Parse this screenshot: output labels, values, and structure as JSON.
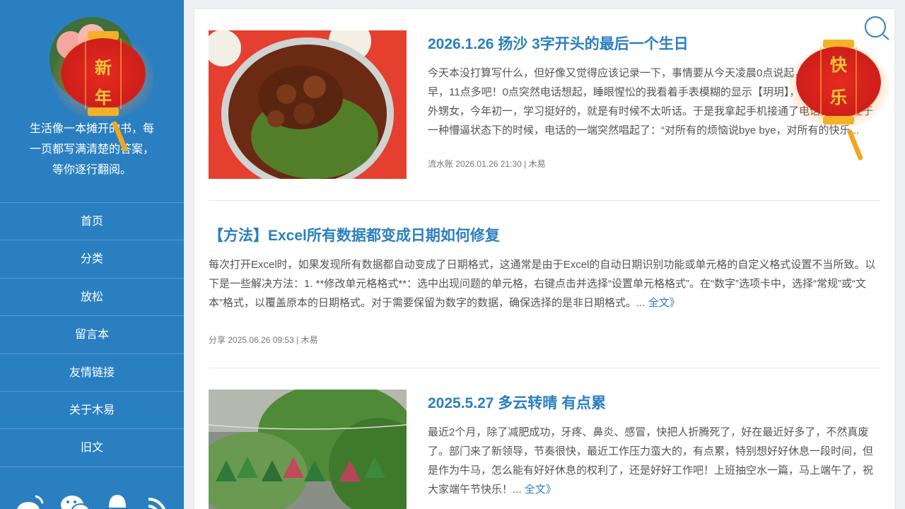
{
  "sidebar": {
    "motto": [
      "生活像一本摊开的书，每",
      "一页都写满清楚的答案，",
      "等你逐行翻阅。"
    ],
    "nav": [
      "首页",
      "分类",
      "放松",
      "留言本",
      "友情链接",
      "关于木易",
      "旧文"
    ],
    "social_icons": [
      "weibo-icon",
      "wechat-icon",
      "qq-icon",
      "rss-icon"
    ]
  },
  "lanterns": {
    "left": {
      "char_top": "新",
      "char_bottom": "年"
    },
    "right": {
      "char_top": "快",
      "char_bottom": "乐"
    }
  },
  "colors": {
    "sidebar": "#2a7fc1",
    "link": "#2a7fc1",
    "lantern_red": "#d4231c",
    "lantern_gold": "#f3b12a"
  },
  "posts": [
    {
      "title": "2026.1.26 扬沙 3字开头的最后一个生日",
      "excerpt": "今天本没打算写什么，但好像又觉得应该记录一下，事情要从今天凌晨0点说起，昨晚睡的比较早，11点多吧！0点突然电话想起，睡眼惺忪的我看着手表模糊的显示【玥玥】，对，就是我的外甥女，今年初一，学习挺好的，就是有时候不太听话。于是我拿起手机接通了电话，在还处于一种懵逼状态下的时候，电话的一端突然唱起了：“对所有的烦恼说bye bye，对所有的快乐...",
      "category": "流水账",
      "date": "2026.01.26 21:30",
      "author": "木易"
    },
    {
      "title": "【方法】Excel所有数据都变成日期如何修复",
      "excerpt": "每次打开Excel时，如果发现所有数据都自动变成了日期格式，这通常是由于Excel的自动日期识别功能或单元格的自定义格式设置不当所致。以下是一些解决方法：1. **修改单元格格式**：选中出现问题的单元格，右键点击并选择“设置单元格格式”。在“数字”选项卡中，选择“常规”或“文本”格式，以覆盖原本的日期格式。对于需要保留为数字的数据，确保选择的是非日期格式。...",
      "readmore": "全文》",
      "category": "分享",
      "date": "2025.06.26 09:53",
      "author": "木易"
    },
    {
      "title": "2025.5.27 多云转晴 有点累",
      "excerpt": "最近2个月，除了减肥成功，牙疼、鼻炎、感冒，快把人折腾死了，好在最近好多了，不然真废了。部门来了新领导，节奏很快，最近工作压力蛮大的，有点累，特别想好好休息一段时间，但是作为牛马，怎么能有好好休息的权利了，还是好好工作吧！上班抽空水一篇，马上端午了，祝大家端午节快乐！...",
      "readmore": "全文》"
    }
  ]
}
